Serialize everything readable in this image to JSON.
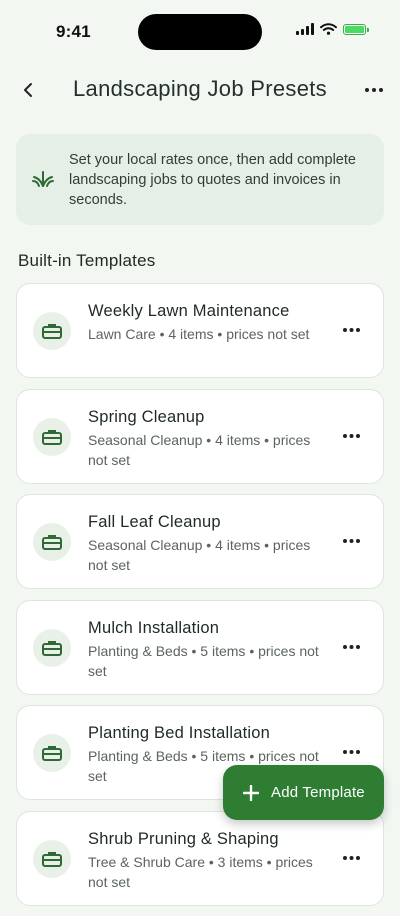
{
  "status_bar": {
    "time": "9:41"
  },
  "header": {
    "title": "Landscaping Job Presets",
    "back_icon": "chevron-left-icon",
    "more_icon": "ellipsis-icon"
  },
  "info": {
    "text": "Set your local rates once, then add complete landscaping jobs to quotes and invoices in seconds.",
    "icon": "grass-icon"
  },
  "section": {
    "title": "Built-in Templates"
  },
  "templates": [
    {
      "title": "Weekly Lawn Maintenance",
      "meta": "Lawn Care • 4 items • prices not set"
    },
    {
      "title": "Spring Cleanup",
      "meta": "Seasonal Cleanup • 4 items • prices not set"
    },
    {
      "title": "Fall Leaf Cleanup",
      "meta": "Seasonal Cleanup • 4 items • prices not set"
    },
    {
      "title": "Mulch Installation",
      "meta": "Planting & Beds • 5 items • prices not set"
    },
    {
      "title": "Planting Bed Installation",
      "meta": "Planting & Beds • 5 items • prices not set"
    },
    {
      "title": "Shrub Pruning & Shaping",
      "meta": "Tree & Shrub Care • 3 items • prices not set"
    }
  ],
  "fab": {
    "label": "Add Template",
    "icon": "plus-icon"
  },
  "colors": {
    "accent": "#2e7d32",
    "background": "#f2f7f2",
    "info_bg": "#e6efe6",
    "icon_bg": "#e8f0e8"
  }
}
